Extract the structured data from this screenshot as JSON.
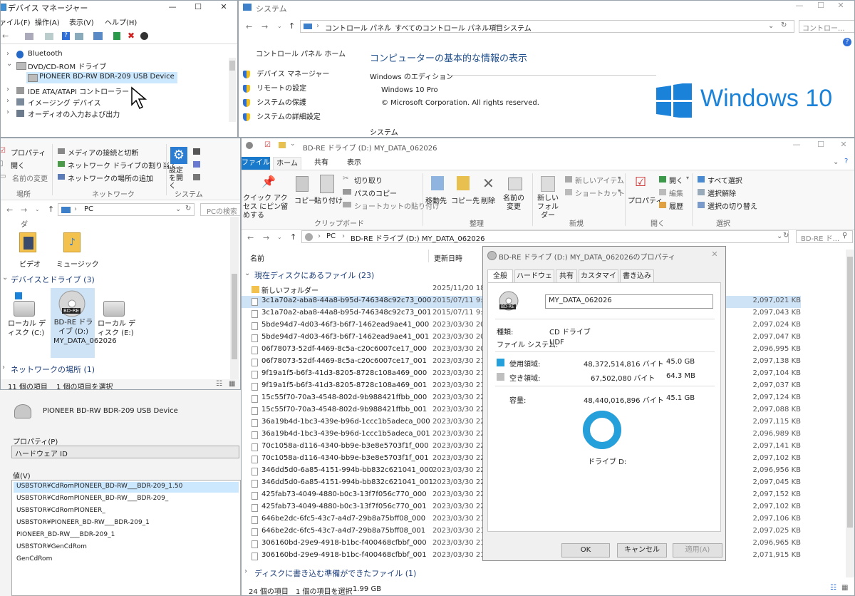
{
  "devmgr": {
    "title": "デバイス マネージャー",
    "menu": [
      "ァイル(F)",
      "操作(A)",
      "表示(V)",
      "ヘルプ(H)"
    ],
    "tree": [
      {
        "label": "Bluetooth"
      },
      {
        "label": "DVD/CD-ROM ドライブ"
      },
      {
        "label": "PIONEER BD-RW   BDR-209 USB Device"
      },
      {
        "label": "IDE ATA/ATAPI コントローラー"
      },
      {
        "label": "イメージング デバイス"
      },
      {
        "label": "オーディオの入力および出力"
      }
    ]
  },
  "system": {
    "title": "システム",
    "breadcrumb": [
      "コントロール パネル",
      "すべてのコントロール パネル項目",
      "システム"
    ],
    "search_placeholder": "コントロー...",
    "home_link": "コントロール パネル ホーム",
    "links": [
      "デバイス マネージャー",
      "リモートの設定",
      "システムの保護",
      "システムの詳細設定"
    ],
    "heading": "コンピューターの基本的な情報の表示",
    "edition_label": "Windows のエディション",
    "edition": "Windows 10 Pro",
    "copyright": "© Microsoft Corporation. All rights reserved.",
    "system_label": "システム",
    "logo_text": "Windows 10"
  },
  "explorer_left": {
    "ribbon": {
      "props": "プロパティ",
      "open": "開く",
      "rename": "名前の変更",
      "group_location": "場所",
      "media": "メディアの接続と切断",
      "map_drive": "ネットワーク ドライブの割り当て",
      "add_location": "ネットワークの場所の追加",
      "group_network": "ネットワーク",
      "settings": "設定を開く",
      "group_system": "システム"
    },
    "address": "PC",
    "search_placeholder": "PCの検索",
    "folders_partial": "ダ",
    "folders": [
      "ビデオ",
      "ミュージック"
    ],
    "devices_header": "デバイスとドライブ (3)",
    "drives": [
      {
        "label": "ローカル ディスク (C:)"
      },
      {
        "label": "BD-RE ドライブ (D:) MY_DATA_062026"
      },
      {
        "label": "ローカル ディスク (E:)"
      }
    ],
    "bd_badge": "BD-RE",
    "network_header": "ネットワークの場所 (1)",
    "status_items": "11 個の項目",
    "status_selected": "1 個の項目を選択"
  },
  "devprops": {
    "device_name": "PIONEER BD-RW   BDR-209 USB Device",
    "property_label": "プロパティ(P)",
    "property_value": "ハードウェア ID",
    "value_label": "値(V)",
    "values": [
      "USBSTOR¥CdRomPIONEER_BD-RW___BDR-209_1.50",
      "USBSTOR¥CdRomPIONEER_BD-RW___BDR-209_",
      "USBSTOR¥CdRomPIONEER_",
      "USBSTOR¥PIONEER_BD-RW___BDR-209_1",
      "PIONEER_BD-RW___BDR-209_1",
      "USBSTOR¥GenCdRom",
      "GenCdRom"
    ]
  },
  "explorer": {
    "title": "BD-RE ドライブ (D:) MY_DATA_062026",
    "tabs": [
      "ファイル",
      "ホーム",
      "共有",
      "表示"
    ],
    "ribbon": {
      "pin": "クイック アクセス にピン留めする",
      "copy": "コピー",
      "paste": "貼り付け",
      "cut": "切り取り",
      "copy_path": "パスのコピー",
      "paste_shortcut": "ショートカットの貼り付け",
      "group_clipboard": "クリップボード",
      "move_to": "移動先",
      "copy_to": "コピー先",
      "delete": "削除",
      "rename": "名前の変更",
      "group_organize": "整理",
      "new_folder": "新しい フォルダー",
      "new_item": "新しいアイテム",
      "shortcut": "ショートカット",
      "group_new": "新規",
      "properties": "プロパティ",
      "open": "開く",
      "edit": "編集",
      "history": "履歴",
      "group_open": "開く",
      "select_all": "すべて選択",
      "select_none": "選択解除",
      "invert": "選択の切り替え",
      "group_select": "選択"
    },
    "breadcrumb": [
      "PC",
      "BD-RE ドライブ (D:) MY_DATA_062026"
    ],
    "search_placeholder": "BD-RE ド...",
    "col_name": "名前",
    "col_date": "更新日時",
    "group_current": "現在ディスクにあるファイル (23)",
    "group_pending": "ディスクに書き込む準備ができたファイル (1)",
    "files": [
      {
        "name": "新しいフォルダー",
        "date": "2025/11/20 18",
        "size": ""
      },
      {
        "name": "3c1a70a2-aba8-44a8-b95d-746348c92c73_000",
        "date": "2015/07/11 9:",
        "size": "2,097,021 KB"
      },
      {
        "name": "3c1a70a2-aba8-44a8-b95d-746348c92c73_001",
        "date": "2015/07/11 9:",
        "size": "2,097,043 KB"
      },
      {
        "name": "5bde94d7-4d03-46f3-b6f7-1462ead9ae41_000",
        "date": "2023/03/30 20",
        "size": "2,097,024 KB"
      },
      {
        "name": "5bde94d7-4d03-46f3-b6f7-1462ead9ae41_001",
        "date": "2023/03/30 20",
        "size": "2,097,047 KB"
      },
      {
        "name": "06f78073-52df-4469-8c5a-c20c6007ce17_000",
        "date": "2023/03/30 20",
        "size": "2,096,995 KB"
      },
      {
        "name": "06f78073-52df-4469-8c5a-c20c6007ce17_001",
        "date": "2023/03/30 21",
        "size": "2,097,138 KB"
      },
      {
        "name": "9f19a1f5-b6f3-41d3-8205-8728c108a469_000",
        "date": "2023/03/30 21",
        "size": "2,097,104 KB"
      },
      {
        "name": "9f19a1f5-b6f3-41d3-8205-8728c108a469_001",
        "date": "2023/03/30 21",
        "size": "2,097,037 KB"
      },
      {
        "name": "15c55f70-70a3-4548-802d-9b988421ffbb_000",
        "date": "2023/03/30 22",
        "size": "2,097,124 KB"
      },
      {
        "name": "15c55f70-70a3-4548-802d-9b988421ffbb_001",
        "date": "2023/03/30 22",
        "size": "2,097,088 KB"
      },
      {
        "name": "36a19b4d-1bc3-439e-b96d-1ccc1b5adeca_000",
        "date": "2023/03/30 22",
        "size": "2,097,115 KB"
      },
      {
        "name": "36a19b4d-1bc3-439e-b96d-1ccc1b5adeca_001",
        "date": "2023/03/30 22",
        "size": "2,096,989 KB"
      },
      {
        "name": "70c1058a-d116-4340-bb9e-b3e8e5703f1f_000",
        "date": "2023/03/30 22",
        "size": "2,097,141 KB"
      },
      {
        "name": "70c1058a-d116-4340-bb9e-b3e8e5703f1f_001",
        "date": "2023/03/30 22",
        "size": "2,097,102 KB"
      },
      {
        "name": "346dd5d0-6a85-4151-994b-bb832c621041_000",
        "date": "2023/03/30 22",
        "size": "2,096,956 KB"
      },
      {
        "name": "346dd5d0-6a85-4151-994b-bb832c621041_001",
        "date": "2023/03/30 22",
        "size": "2,097,045 KB"
      },
      {
        "name": "425fab73-4049-4880-b0c3-13f7f056c770_000",
        "date": "2023/03/30 22",
        "size": "2,097,152 KB"
      },
      {
        "name": "425fab73-4049-4880-b0c3-13f7f056c770_001",
        "date": "2023/03/30 22",
        "size": "2,097,102 KB"
      },
      {
        "name": "646be2dc-6fc5-43c7-a4d7-29b8a75bff08_000",
        "date": "2023/03/30 21",
        "size": "2,097,106 KB"
      },
      {
        "name": "646be2dc-6fc5-43c7-a4d7-29b8a75bff08_001",
        "date": "2023/03/30 21",
        "size": "2,097,025 KB"
      },
      {
        "name": "306160bd-29e9-4918-b1bc-f400468cfbbf_000",
        "date": "2023/03/30 21",
        "size": "2,096,965 KB"
      },
      {
        "name": "306160bd-29e9-4918-b1bc-f400468cfbbf_001",
        "date": "2023/03/30 21",
        "size": "2,071,915 KB"
      }
    ],
    "status_items": "24 個の項目",
    "status_selected": "1 個の項目を選択",
    "status_size": "1.99 GB"
  },
  "props_dialog": {
    "title": "BD-RE ドライブ (D:) MY_DATA_062026のプロパティ",
    "tabs": [
      "全般",
      "ハードウェア",
      "共有",
      "カスタマイズ",
      "書き込み"
    ],
    "drive_badge": "BD-RE",
    "label_value": "MY_DATA_062026",
    "type_label": "種類:",
    "type_value": "CD ドライブ",
    "fs_label": "ファイル システム:",
    "fs_value": "UDF",
    "used_label": "使用領域:",
    "used_bytes": "48,372,514,816 バイト",
    "used_gb": "45.0 GB",
    "free_label": "空き領域:",
    "free_bytes": "67,502,080 バイト",
    "free_gb": "64.3 MB",
    "capacity_label": "容量:",
    "capacity_bytes": "48,440,016,896 バイト",
    "capacity_gb": "45.1 GB",
    "used_fraction": 0.9986,
    "used_color": "#26a0da",
    "free_color": "#bfbfbf",
    "drive_caption": "ドライブ D:",
    "ok": "OK",
    "cancel": "キャンセル",
    "apply": "適用(A)"
  }
}
